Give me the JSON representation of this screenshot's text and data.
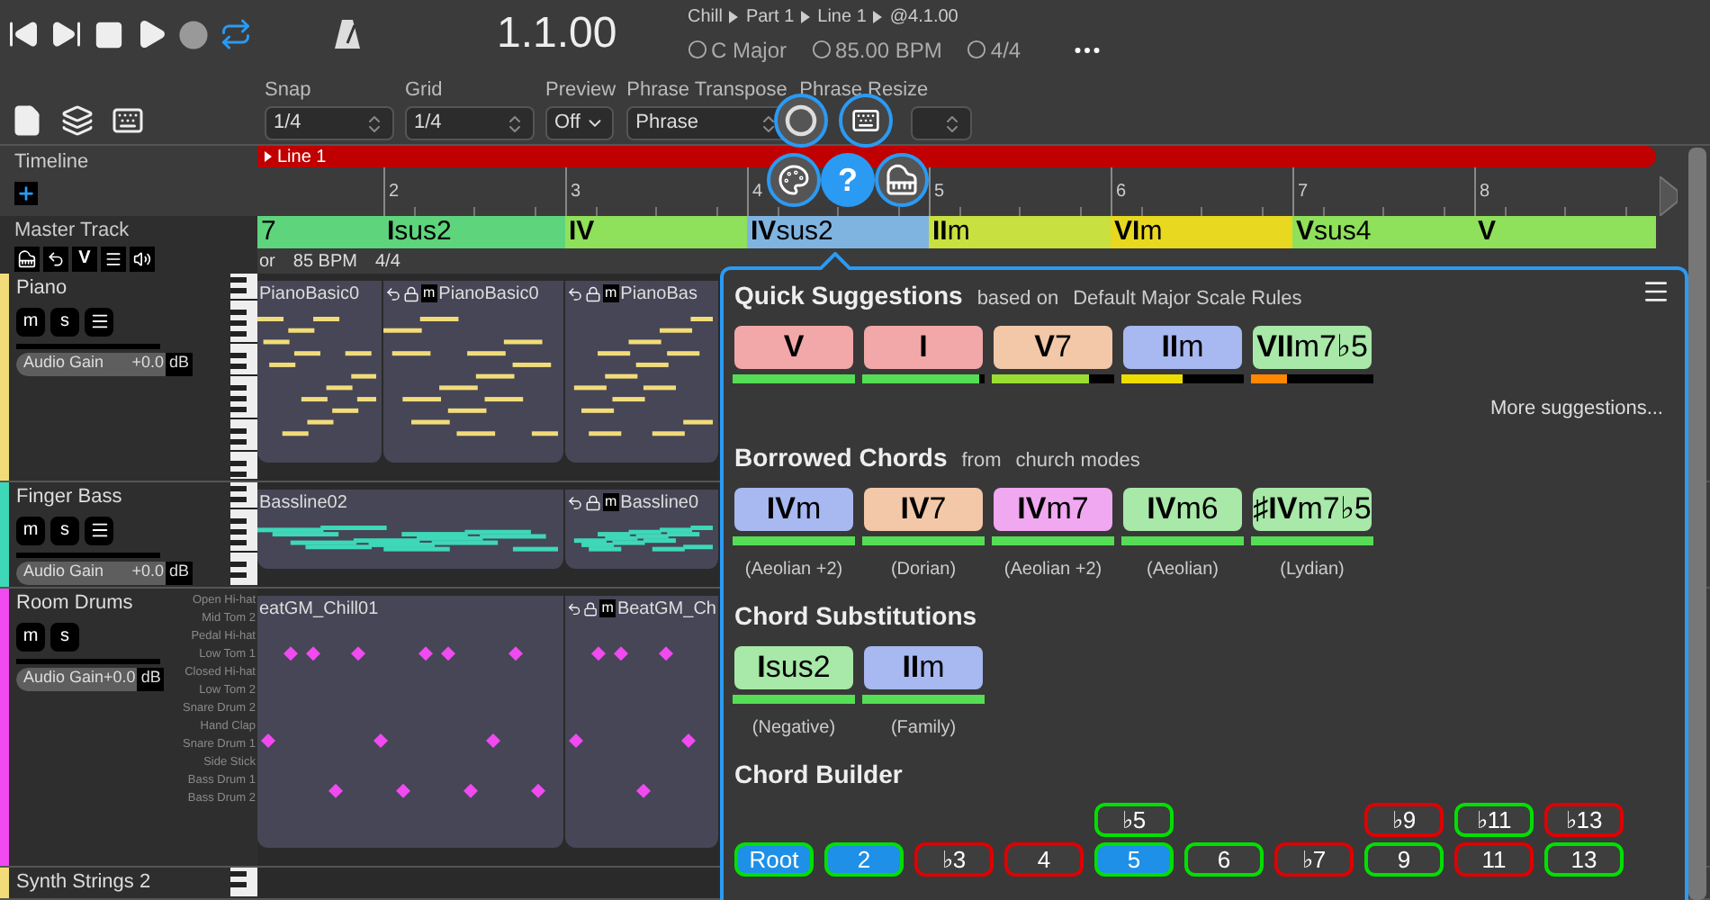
{
  "transport": {
    "time": "1.1.00",
    "breadcrumb": [
      "Chill",
      "Part 1",
      "Line 1",
      "@4.1.00"
    ],
    "loop_on": true,
    "key": "C Major",
    "tempo": "85.00 BPM",
    "meter": "4/4"
  },
  "toolbar": [
    {
      "label": "Snap",
      "value": "1/4",
      "kind": "spin"
    },
    {
      "label": "Grid",
      "value": "1/4",
      "kind": "spin"
    },
    {
      "label": "Preview",
      "value": "Off",
      "kind": "dropdown"
    },
    {
      "label": "Phrase Transpose",
      "value": "Phrase",
      "kind": "spin"
    },
    {
      "label": "Phrase Resize",
      "kind": "spin"
    }
  ],
  "help": "?",
  "timeline": {
    "title": "Timeline",
    "line": "Line 1",
    "bars": [
      "2",
      "3",
      "4",
      "5",
      "6",
      "7",
      "8"
    ]
  },
  "master": {
    "title": "Master Track",
    "button": "V",
    "info": [
      "or",
      "85 BPM",
      "4/4"
    ]
  },
  "chords": [
    {
      "label": "7",
      "color": "#5ed47c"
    },
    {
      "label": "**I**sus2",
      "color": "#5ed47c"
    },
    {
      "label": "**IV**",
      "color": "#8fe05a"
    },
    {
      "label": "**IV**sus2",
      "color": "#80b4e0"
    },
    {
      "label": "**II**m",
      "color": "#c8e040"
    },
    {
      "label": "**VI**m",
      "color": "#e8d820"
    },
    {
      "label": "**V**sus4",
      "color": "#8fe05a"
    },
    {
      "label": "**V**",
      "color": "#8fe05a"
    }
  ],
  "tracks": [
    {
      "name": "Piano",
      "kind": "keys",
      "color": "#f2dc7a",
      "buttons": [
        "m",
        "s"
      ],
      "gain_label": "Audio Gain",
      "level": 1,
      "gain": "+0.0",
      "unit": "dB",
      "clips": [
        {
          "name": "PianoBasic0"
        },
        {
          "name": "PianoBasic0",
          "badge": "m"
        },
        {
          "name": "PianoBas",
          "badge": "m"
        }
      ]
    },
    {
      "name": "Finger Bass",
      "kind": "keys",
      "color": "#3ed8b8",
      "buttons": [
        "m",
        "s"
      ],
      "gain_label": "Audio Gain",
      "level": 1,
      "gain": "+0.0",
      "unit": "dB",
      "clips": [
        {
          "name": "Bassline02"
        },
        {
          "name": "Bassline0",
          "badge": "m"
        }
      ]
    },
    {
      "name": "Room Drums",
      "kind": "drums",
      "color": "#f04af0",
      "buttons": [
        "m",
        "s"
      ],
      "gain_label": "Audio Gain",
      "level": 1,
      "gain": "+0.0",
      "unit": "dB",
      "lanes": [
        "Open Hi-hat",
        "Mid Tom 2",
        "Pedal Hi-hat",
        "Low Tom 1",
        "Closed Hi-hat",
        "Low Tom 2",
        "Snare Drum 2",
        "Hand Clap",
        "Snare Drum 1",
        "Side Stick",
        "Bass Drum 1",
        "Bass Drum 2"
      ],
      "clips": [
        {
          "name": "eatGM_Chill01"
        },
        {
          "name": "BeatGM_Ch",
          "badge": "m"
        }
      ]
    },
    {
      "name": "Synth Strings 2",
      "kind": "stub",
      "color": "#f2dc7a"
    }
  ],
  "panel": {
    "quick": {
      "title": "Quick Suggestions",
      "note": "based on",
      "source": "Default Major Scale Rules",
      "more": "More suggestions...",
      "chords": [
        {
          "label": "**V**",
          "color": "#f2a8a8",
          "level": 1
        },
        {
          "label": "**I**",
          "color": "#f2a8a8",
          "level": 0.95
        },
        {
          "label": "**V**7",
          "color": "#f2c8a8",
          "level": 0.8
        },
        {
          "label": "**II**m",
          "color": "#a8b8f0",
          "level": 0.5
        },
        {
          "label": "**VII**m7♭5",
          "color": "#a8e8a8",
          "level": 0.3
        }
      ]
    },
    "borrowed": {
      "title": "Borrowed Chords",
      "note": "from",
      "source": "church modes",
      "chords": [
        {
          "label": "**IV**m",
          "color": "#a8b8f0",
          "level": 1,
          "caption": "(Aeolian +2)"
        },
        {
          "label": "**IV**7",
          "color": "#f2c8a8",
          "level": 1,
          "caption": "(Dorian)"
        },
        {
          "label": "**IV**m7",
          "color": "#f0a8f0",
          "level": 1,
          "caption": "(Aeolian +2)"
        },
        {
          "label": "**IV**m6",
          "color": "#a8e8a8",
          "level": 1,
          "caption": "(Aeolian)"
        },
        {
          "label": "♯**IV**m7♭5",
          "color": "#a8e8a8",
          "level": 1,
          "caption": "(Lydian)"
        }
      ]
    },
    "substitutions": {
      "title": "Chord Substitutions",
      "chords": [
        {
          "label": "**I**sus2",
          "color": "#a8e8a8",
          "level": 1,
          "caption": "(Negative)"
        },
        {
          "label": "**II**m",
          "color": "#a8b8f0",
          "level": 1,
          "caption": "(Family)"
        }
      ]
    },
    "builder": {
      "title": "Chord Builder",
      "columns": [
        [
          {
            "label": "Root",
            "selected": true,
            "color": "#00e000"
          }
        ],
        [
          {
            "label": "2",
            "selected": true,
            "color": "#00e000"
          }
        ],
        [
          {
            "label": "♭3",
            "selected": false,
            "color": "#e00000"
          }
        ],
        [
          {
            "label": "4",
            "selected": false,
            "color": "#e00000"
          }
        ],
        [
          {
            "label": "♭5",
            "selected": false,
            "color": "#00e000"
          },
          {
            "label": "5",
            "selected": true,
            "color": "#00e000"
          }
        ],
        [
          {
            "label": "6",
            "selected": false,
            "color": "#00e000"
          }
        ],
        [
          {
            "label": "♭7",
            "selected": false,
            "color": "#e00000"
          }
        ],
        [
          {
            "label": "♭9",
            "selected": false,
            "color": "#e00000"
          },
          {
            "label": "9",
            "selected": false,
            "color": "#00e000"
          }
        ],
        [
          {
            "label": "♭11",
            "selected": false,
            "color": "#00e000"
          },
          {
            "label": "11",
            "selected": false,
            "color": "#e00000"
          }
        ],
        [
          {
            "label": "♭13",
            "selected": false,
            "color": "#e00000"
          },
          {
            "label": "13",
            "selected": false,
            "color": "#00e000"
          }
        ]
      ]
    }
  }
}
